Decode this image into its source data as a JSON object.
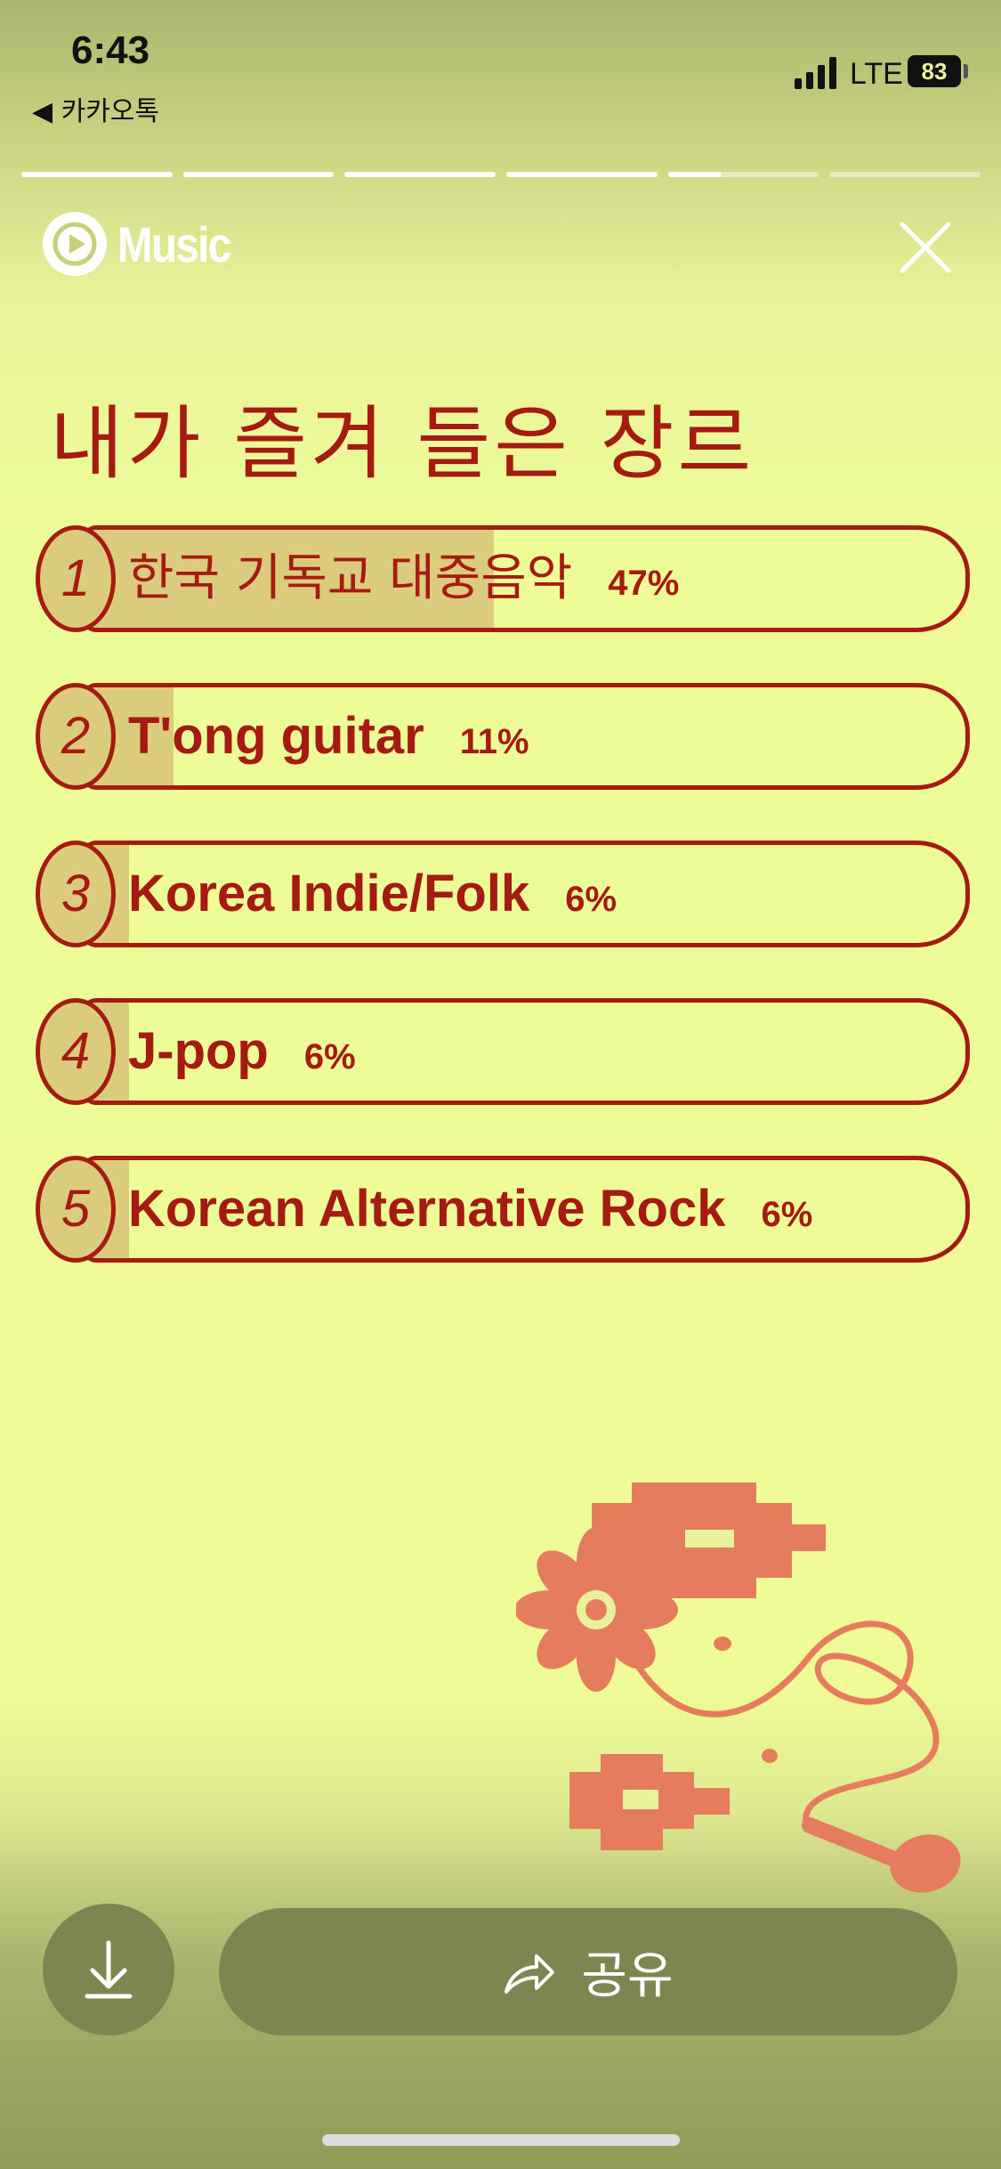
{
  "status_bar": {
    "time": "6:43",
    "back_app": "◀ 카카오톡",
    "network": "LTE",
    "battery": "83"
  },
  "story_progress": {
    "segments": 6,
    "current_index": 4,
    "current_fraction": 0.35
  },
  "header": {
    "brand": "Music",
    "logo_icon": "youtube-music-play-icon",
    "close_icon": "close-icon"
  },
  "page": {
    "title": "내가 즐겨 들은 장르"
  },
  "genres": [
    {
      "rank": "1",
      "name": "한국 기독교 대중음악",
      "percent": "47%",
      "value": 47
    },
    {
      "rank": "2",
      "name": "T'ong guitar",
      "percent": "11%",
      "value": 11
    },
    {
      "rank": "3",
      "name": "Korea Indie/Folk",
      "percent": "6%",
      "value": 6
    },
    {
      "rank": "4",
      "name": "J-pop",
      "percent": "6%",
      "value": 6
    },
    {
      "rank": "5",
      "name": "Korean Alternative Rock",
      "percent": "6%",
      "value": 6
    }
  ],
  "actions": {
    "download_icon": "download-icon",
    "share_icon": "share-arrow-icon",
    "share_label": "공유"
  },
  "colors": {
    "accent": "#a51a11",
    "bar_fill": "#dbcb7c",
    "illustration": "#e57c5e",
    "button": "#7b8650"
  }
}
